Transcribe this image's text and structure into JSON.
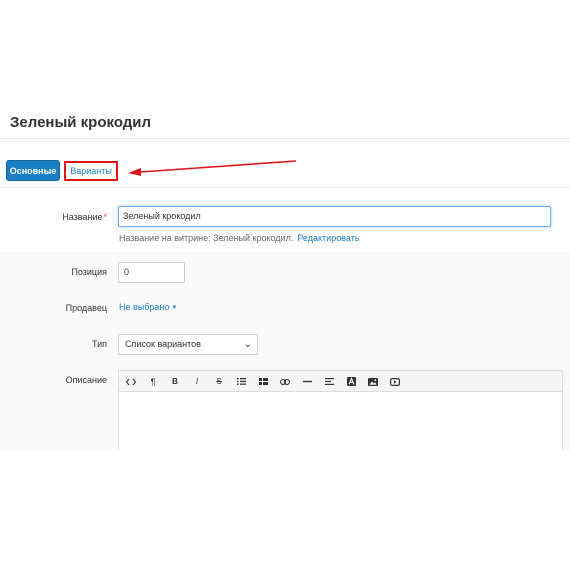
{
  "page": {
    "title": "Зеленый крокодил"
  },
  "tabs": {
    "main": "Основные",
    "variants": "Варианты"
  },
  "form": {
    "name": {
      "label": "Название",
      "required_mark": "*",
      "value": "Зеленый крокодил"
    },
    "storefront_hint": {
      "text": "Название на витрине: Зеленый крокодил.",
      "edit_link": "Редактировать"
    },
    "position": {
      "label": "Позиция",
      "value": "0"
    },
    "seller": {
      "label": "Продавец",
      "value": "Не выбрано"
    },
    "type": {
      "label": "Тип",
      "selected": "Список вариантов"
    },
    "description": {
      "label": "Описание",
      "toolbar": [
        "code-view-icon",
        "paragraph-icon",
        "bold-icon",
        "italic-icon",
        "strikethrough-icon",
        "unordered-list-icon",
        "ordered-list-icon",
        "link-icon",
        "horizontal-rule-icon",
        "align-icon",
        "font-color-icon",
        "image-icon",
        "video-icon"
      ]
    }
  },
  "colors": {
    "primary": "#1a7fc4",
    "highlight": "#e1161b",
    "required": "#d9534f"
  }
}
